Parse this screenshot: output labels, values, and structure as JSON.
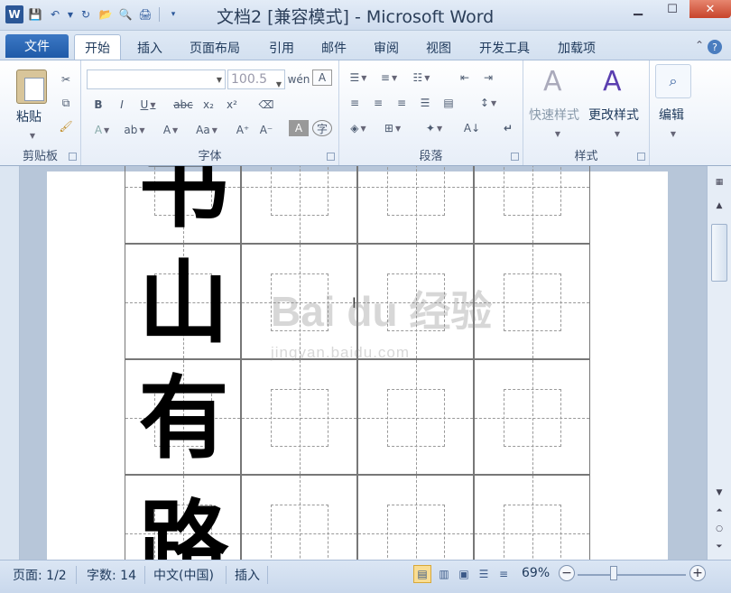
{
  "window": {
    "title": "文档2 [兼容模式] - Microsoft Word",
    "app_icon": "W"
  },
  "tabs": {
    "file": "文件",
    "items": [
      "开始",
      "插入",
      "页面布局",
      "引用",
      "邮件",
      "审阅",
      "视图",
      "开发工具",
      "加载项"
    ],
    "active": "开始"
  },
  "ribbon": {
    "clipboard": {
      "label": "剪贴板",
      "paste": "粘贴"
    },
    "font": {
      "label": "字体",
      "font_name": "",
      "font_size": "100.5"
    },
    "paragraph": {
      "label": "段落"
    },
    "styles": {
      "label": "样式",
      "quick_styles": "快速样式",
      "change_styles": "更改样式"
    },
    "editing": {
      "label": "编辑",
      "edit": "编辑"
    }
  },
  "document": {
    "characters": [
      "书",
      "山",
      "有",
      "路"
    ]
  },
  "watermark": {
    "brand": "Bai du 经验",
    "url": "jingyan.baidu.com"
  },
  "status": {
    "page": "页面: 1/2",
    "words": "字数: 14",
    "language": "中文(中国)",
    "mode": "插入",
    "zoom": "69%"
  }
}
